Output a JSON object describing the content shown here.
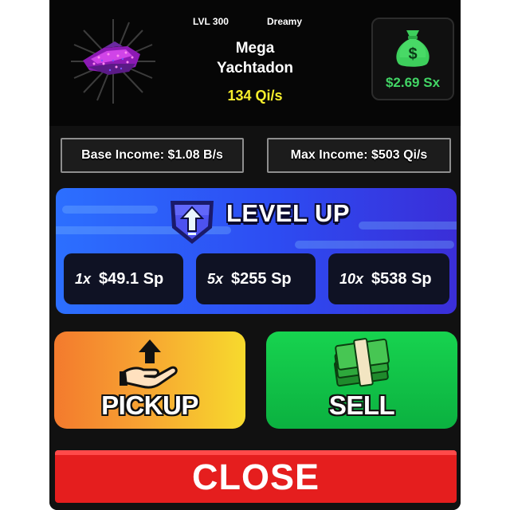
{
  "header": {
    "level": "LVL 300",
    "mutation": "Dreamy",
    "name_line1": "Mega",
    "name_line2": "Yachtadon",
    "income_rate": "134 Qi/s"
  },
  "cash": {
    "icon": "money-bag-icon",
    "value": "$2.69 Sx",
    "color": "#42d565"
  },
  "stats": {
    "base_income": "Base Income: $1.08 B/s",
    "max_income": "Max Income: $503 Qi/s"
  },
  "level_up": {
    "title": "LEVEL UP",
    "icon": "up-arrow-shield-icon",
    "options": [
      {
        "multiplier": "1x",
        "cost": "$49.1 Sp"
      },
      {
        "multiplier": "5x",
        "cost": "$255 Sp"
      },
      {
        "multiplier": "10x",
        "cost": "$538 Sp"
      }
    ]
  },
  "actions": {
    "pickup_label": "PICKUP",
    "pickup_icon": "hand-up-arrow-icon",
    "sell_label": "SELL",
    "sell_icon": "money-stack-icon"
  },
  "close_label": "CLOSE",
  "colors": {
    "level_up_bg": "#2d4cf2",
    "pickup_bg": "#f7a232",
    "sell_bg": "#17d34f",
    "close_bg": "#e51e1e",
    "rate_yellow": "#f6ee2c"
  }
}
